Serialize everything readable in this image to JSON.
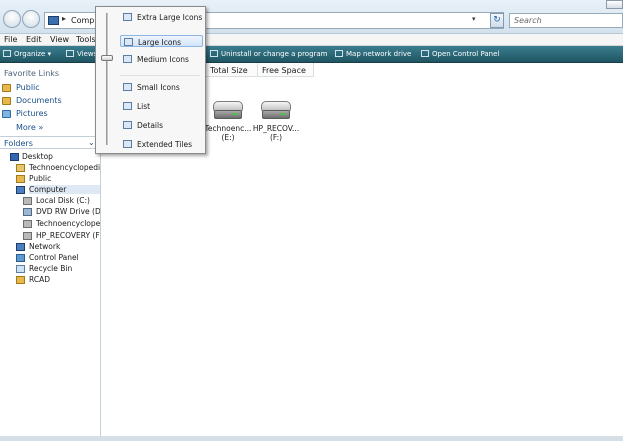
{
  "address": {
    "path_text": "Computer",
    "search_placeholder": "Search"
  },
  "menu": [
    {
      "label": "File"
    },
    {
      "label": "Edit"
    },
    {
      "label": "View"
    },
    {
      "label": "Tools"
    }
  ],
  "toolbar": {
    "organize": "Organize",
    "views": "Views",
    "uninstall": "Uninstall or change a program",
    "map_drive": "Map network drive",
    "control_panel": "Open Control Panel"
  },
  "favorites": {
    "header": "Favorite Links",
    "items": [
      {
        "label": "Public",
        "icon": "folder-icon"
      },
      {
        "label": "Documents",
        "icon": "documents-icon"
      },
      {
        "label": "Pictures",
        "icon": "pictures-icon"
      }
    ],
    "more": "More"
  },
  "folders": {
    "label": "Folders",
    "tree": [
      {
        "label": "Desktop",
        "icon": "desktop-icon"
      },
      {
        "label": "Technoencyclopedi",
        "icon": "user-folder-icon"
      },
      {
        "label": "Public",
        "icon": "folder-icon"
      },
      {
        "label": "Computer",
        "icon": "computer-icon"
      },
      {
        "label": "Local Disk (C:)",
        "icon": "drive-icon"
      },
      {
        "label": "DVD RW Drive (D:)",
        "icon": "dvd-drive-icon"
      },
      {
        "label": "Technoencyclope",
        "icon": "drive-icon"
      },
      {
        "label": "HP_RECOVERY (F:",
        "icon": "drive-icon"
      },
      {
        "label": "Network",
        "icon": "network-icon"
      },
      {
        "label": "Control Panel",
        "icon": "control-panel-icon"
      },
      {
        "label": "Recycle Bin",
        "icon": "recycle-bin-icon"
      },
      {
        "label": "RCAD",
        "icon": "folder-icon"
      }
    ]
  },
  "columns": {
    "total_size": "Total Size",
    "free_space": "Free Space"
  },
  "drives": [
    {
      "name": "Technoenc...",
      "letter": "(E:)"
    },
    {
      "name": "HP_RECOV...",
      "letter": "(F:)"
    }
  ],
  "view_menu": {
    "items": [
      {
        "label": "Extra Large Icons"
      },
      {
        "label": "Large Icons"
      },
      {
        "label": "Medium Icons"
      },
      {
        "label": "Small Icons"
      },
      {
        "label": "List"
      },
      {
        "label": "Details"
      },
      {
        "label": "Extended Tiles"
      }
    ],
    "selected": "Large Icons"
  },
  "colors": {
    "toolbar_top": "#3a7d8e",
    "toolbar_bottom": "#1f5563",
    "link_blue": "#1a4f8c",
    "selection": "#d3e4f8"
  }
}
